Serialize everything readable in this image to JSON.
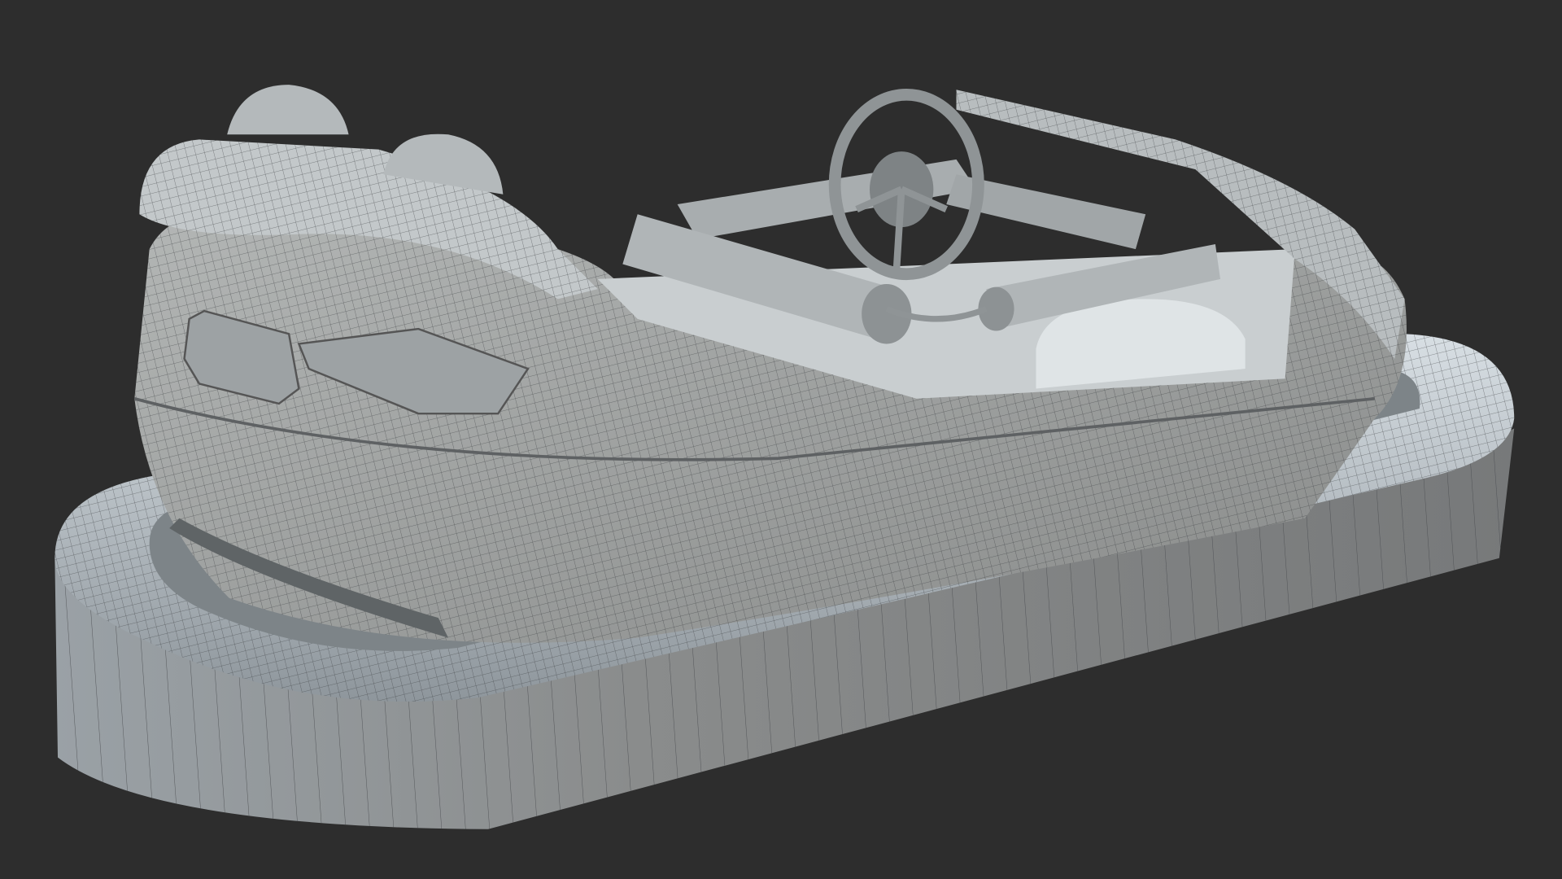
{
  "scene": {
    "subject": "bumper-car-wireframe-render",
    "colors": {
      "background": "#2d2d2d",
      "surface": "#8f9496",
      "surface_light": "#b9c0c4",
      "wire": "#3a3d40"
    }
  }
}
